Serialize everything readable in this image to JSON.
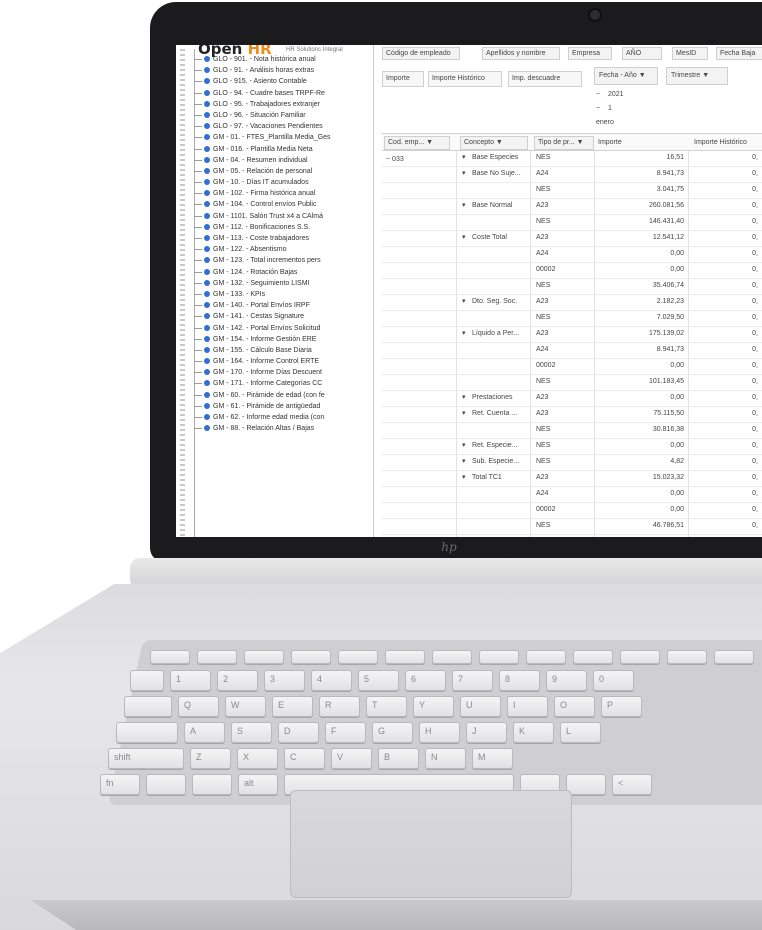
{
  "app": {
    "brand_main": "Open",
    "brand_accent": "HR",
    "brand_subtitle": "HR Solutions Integral"
  },
  "tree": {
    "items": [
      "GLO - 901. - Nota histórica anual",
      "GLO - 91. - Análisis horas extras",
      "GLO - 915. - Asiento Contable",
      "GLO - 94. - Cuadre bases TRPF-Re",
      "GLO - 95. - Trabajadores extranjer",
      "GLO - 96. - Situación Familiar",
      "GLO - 97. - Vacaciones Pendientes",
      "GM - 01. - FTES_Plantilla Media_Ges",
      "GM - 016. - Plantilla Media Neta",
      "GM - 04. - Resumen individual",
      "GM - 05. - Relación de personal",
      "GM - 10. - Días IT acumulados",
      "GM - 102. - Firma histórica anual",
      "GM - 104. - Control envíos Public",
      "GM - 1101. Salón Trust x4 a CAlmá",
      "GM - 112. - Bonificaciones S.S.",
      "GM - 113. - Coste trabajadores",
      "GM - 122. - Absentismo",
      "GM - 123. - Total incrementos pers",
      "GM - 124. - Rotación Bajas",
      "GM - 132. - Seguimiento LISMI",
      "GM - 133. - KPIs",
      "GM - 140. - Portal Envíos IRPF",
      "GM - 141. - Cestas Signature",
      "GM - 142. - Portal Envíos Solicitud",
      "GM - 154. - Informe Gestión ERE",
      "GM - 155. - Cálculo Base Diaria",
      "GM - 164. - Informe Control ERTE",
      "GM - 170. - Informe Días Descuent",
      "GM - 171. - Informe Categorías CC",
      "GM - 60. - Pirámide de edad (con fe",
      "GM - 61. - Pirámide de antigüedad",
      "GM - 62. - Informe edad media (con",
      "GM - 88. - Relación Altas / Bajas"
    ]
  },
  "pivot": {
    "filter_fields": [
      "Código de empleado",
      "Apellidos y nombre",
      "Empresa",
      "AÑO",
      "MesID",
      "Fecha Baja"
    ],
    "data_fields": [
      "Importe",
      "Importe Histórico",
      "Imp. descuadre"
    ],
    "column_filters": [
      "Fecha - Año",
      "Trimestre"
    ],
    "column_values": [
      "2021",
      "1",
      "enero"
    ],
    "column_headers": [
      "Importe",
      "Importe Histórico"
    ],
    "row_headers": [
      "Cod. emp...",
      "Concepto",
      "Tipo de pr..."
    ],
    "sort_arrow": "▼",
    "expand_minus": "−",
    "collapse_marker": "▾",
    "employee": "033",
    "rows": [
      {
        "concepto": "Base Especies",
        "tipo": "NES",
        "importe": "16,51",
        "hist": "0,"
      },
      {
        "concepto": "Base No Suje...",
        "tipo": "A24",
        "importe": "8.941,73",
        "hist": "0,"
      },
      {
        "concepto": "",
        "tipo": "NES",
        "importe": "3.041,75",
        "hist": "0,"
      },
      {
        "concepto": "Base Normal",
        "tipo": "A23",
        "importe": "260.081,56",
        "hist": "0,"
      },
      {
        "concepto": "",
        "tipo": "NES",
        "importe": "146.431,40",
        "hist": "0,"
      },
      {
        "concepto": "Coste Total",
        "tipo": "A23",
        "importe": "12.541,12",
        "hist": "0,"
      },
      {
        "concepto": "",
        "tipo": "A24",
        "importe": "0,00",
        "hist": "0,"
      },
      {
        "concepto": "",
        "tipo": "00002",
        "importe": "0,00",
        "hist": "0,"
      },
      {
        "concepto": "",
        "tipo": "NES",
        "importe": "35.406,74",
        "hist": "0,"
      },
      {
        "concepto": "Dto. Seg. Soc.",
        "tipo": "A23",
        "importe": "2.182,23",
        "hist": "0,"
      },
      {
        "concepto": "",
        "tipo": "NES",
        "importe": "7.029,50",
        "hist": "0,"
      },
      {
        "concepto": "Líquido a Per...",
        "tipo": "A23",
        "importe": "175.139,02",
        "hist": "0,"
      },
      {
        "concepto": "",
        "tipo": "A24",
        "importe": "8.941,73",
        "hist": "0,"
      },
      {
        "concepto": "",
        "tipo": "00002",
        "importe": "0,00",
        "hist": "0,"
      },
      {
        "concepto": "",
        "tipo": "NES",
        "importe": "101.183,45",
        "hist": "0,"
      },
      {
        "concepto": "Prestaciones",
        "tipo": "A23",
        "importe": "0,00",
        "hist": "0,"
      },
      {
        "concepto": "Ret. Cuenta ...",
        "tipo": "A23",
        "importe": "75.115,50",
        "hist": "0,"
      },
      {
        "concepto": "",
        "tipo": "NES",
        "importe": "30.816,38",
        "hist": "0,"
      },
      {
        "concepto": "Ret. Especie...",
        "tipo": "NES",
        "importe": "0,00",
        "hist": "0,"
      },
      {
        "concepto": "Sub. Especie...",
        "tipo": "NES",
        "importe": "4,82",
        "hist": "0,"
      },
      {
        "concepto": "Total TC1",
        "tipo": "A23",
        "importe": "15.023,32",
        "hist": "0,"
      },
      {
        "concepto": "",
        "tipo": "A24",
        "importe": "0,00",
        "hist": "0,"
      },
      {
        "concepto": "",
        "tipo": "00002",
        "importe": "0,00",
        "hist": "0,"
      },
      {
        "concepto": "",
        "tipo": "NES",
        "importe": "46.786,51",
        "hist": "0,"
      }
    ]
  },
  "laptop": {
    "logo": "hp",
    "keys_row1": [
      "1",
      "2",
      "3",
      "4",
      "5",
      "6",
      "7",
      "8",
      "9",
      "0"
    ],
    "keys_row2": [
      "Q",
      "W",
      "E",
      "R",
      "T",
      "Y",
      "U",
      "I",
      "O",
      "P"
    ],
    "keys_row3": [
      "A",
      "S",
      "D",
      "F",
      "G",
      "H",
      "J",
      "K",
      "L"
    ],
    "keys_row4": [
      "Z",
      "X",
      "C",
      "V",
      "B",
      "N",
      "M"
    ],
    "key_shift": "shift",
    "key_fn": "fn",
    "key_alt": "alt",
    "key_lt": "<"
  }
}
